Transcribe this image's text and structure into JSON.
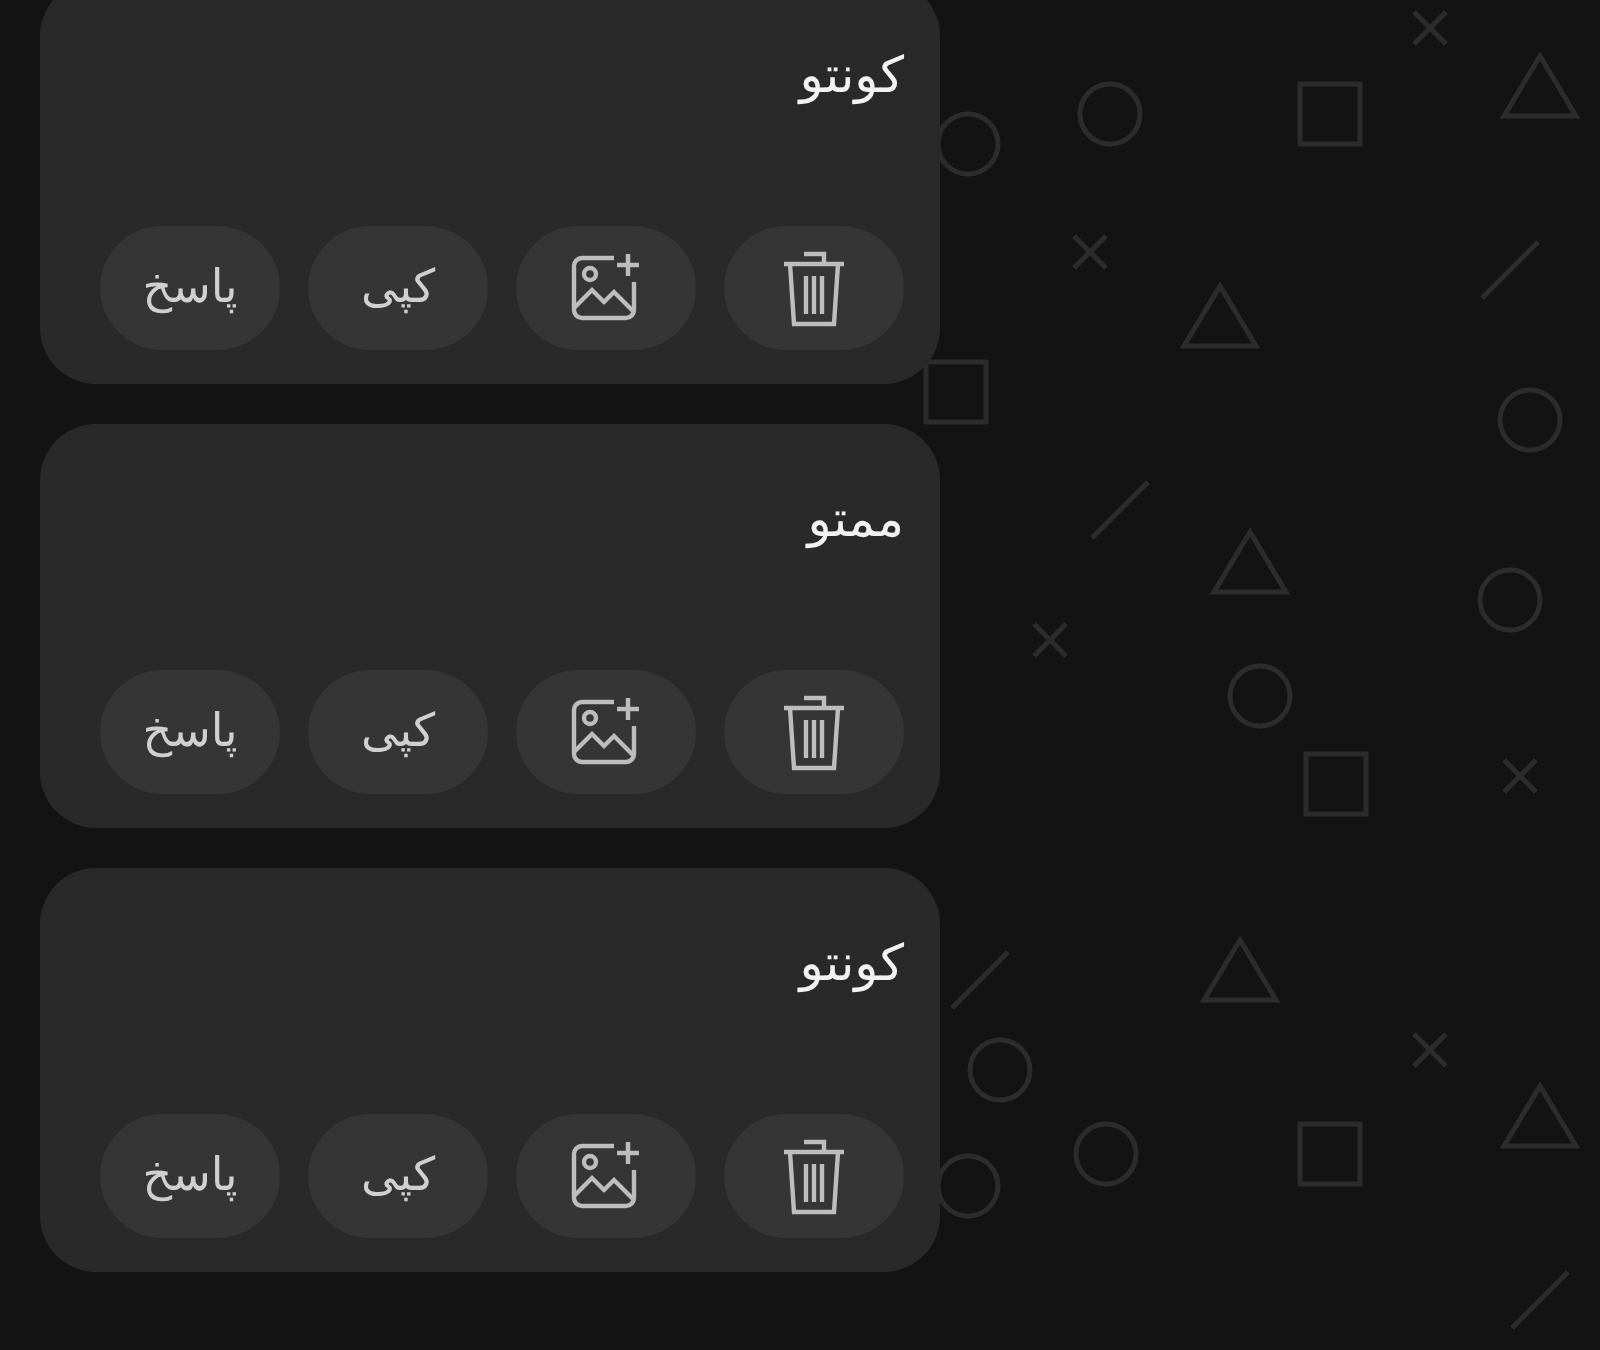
{
  "messages": [
    {
      "text": "کونتو",
      "actions": [
        {
          "kind": "delete"
        },
        {
          "kind": "add-image"
        },
        {
          "kind": "text",
          "label": "کپی"
        },
        {
          "kind": "text",
          "label": "پاسخ"
        }
      ]
    },
    {
      "text": "ممتو",
      "actions": [
        {
          "kind": "delete"
        },
        {
          "kind": "add-image"
        },
        {
          "kind": "text",
          "label": "کپی"
        },
        {
          "kind": "text",
          "label": "پاسخ"
        }
      ]
    },
    {
      "text": "کونتو",
      "actions": [
        {
          "kind": "delete"
        },
        {
          "kind": "add-image"
        },
        {
          "kind": "text",
          "label": "کپی"
        },
        {
          "kind": "text",
          "label": "پاسخ"
        }
      ]
    }
  ]
}
